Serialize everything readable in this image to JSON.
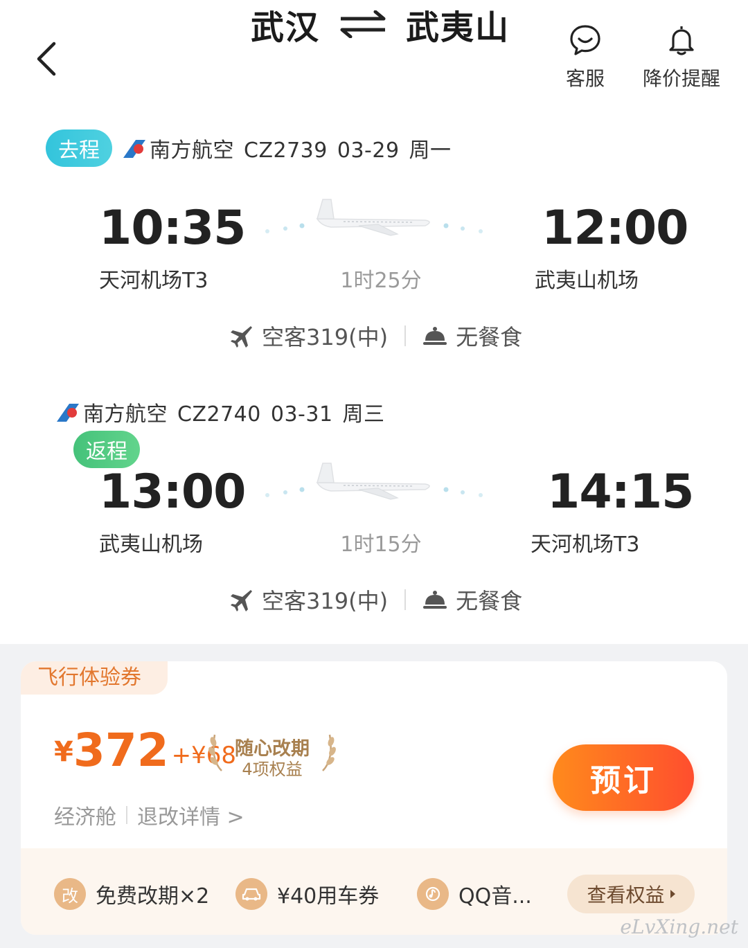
{
  "header": {
    "from_city": "武汉",
    "to_city": "武夷山",
    "service_label": "客服",
    "alert_label": "降价提醒"
  },
  "outbound": {
    "tag": "去程",
    "airline": "南方航空",
    "flight_no": "CZ2739",
    "date": "03-29",
    "weekday": "周一",
    "dep_time": "10:35",
    "dep_airport": "天河机场T3",
    "arr_time": "12:00",
    "arr_airport": "武夷山机场",
    "duration": "1时25分",
    "aircraft": "空客319(中)",
    "meal": "无餐食"
  },
  "return": {
    "tag": "返程",
    "airline": "南方航空",
    "flight_no": "CZ2740",
    "date": "03-31",
    "weekday": "周三",
    "dep_time": "13:00",
    "dep_airport": "武夷山机场",
    "arr_time": "14:15",
    "arr_airport": "天河机场T3",
    "duration": "1时15分",
    "aircraft": "空客319(中)",
    "meal": "无餐食"
  },
  "offer": {
    "tag": "飞行体验券",
    "currency": "¥",
    "price": "372",
    "extra": "+¥68",
    "perk_title": "随心改期",
    "perk_sub": "4项权益",
    "cabin": "经济舱",
    "refund_link": "退改详情 >",
    "book_label": "预订",
    "benefits": [
      {
        "icon_text": "改",
        "label": "免费改期×2"
      },
      {
        "icon_text": "",
        "label": "¥40用车券"
      },
      {
        "icon_text": "",
        "label": "QQ音..."
      }
    ],
    "view_label": "查看权益"
  },
  "watermark": "eLvXing.net",
  "colors": {
    "go_tag": "#33c4dc",
    "return_tag": "#45c27a",
    "price": "#f06b1c",
    "book_gradient_start": "#ff8a1c",
    "book_gradient_end": "#ff4e2e"
  }
}
